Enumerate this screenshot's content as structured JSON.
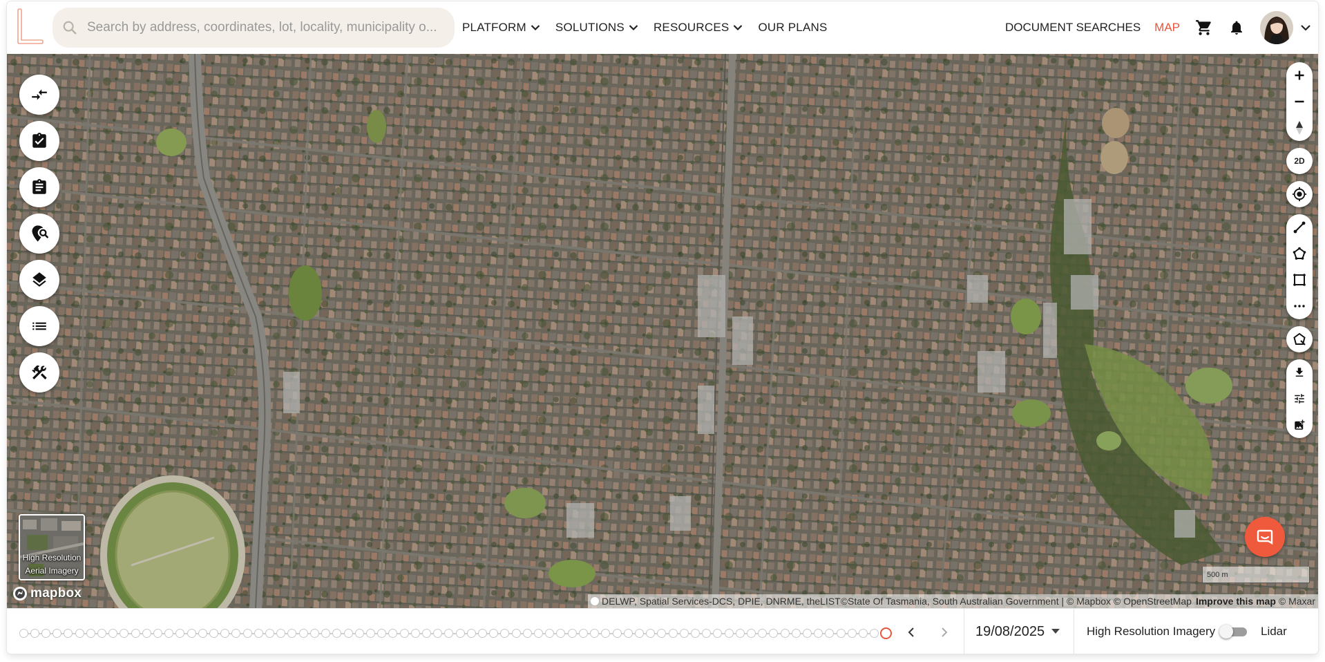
{
  "header": {
    "search": {
      "placeholder": "Search by address, coordinates, lot, locality, municipality o..."
    },
    "nav": [
      {
        "label": "PLATFORM",
        "dropdown": true
      },
      {
        "label": "SOLUTIONS",
        "dropdown": true
      },
      {
        "label": "RESOURCES",
        "dropdown": true
      },
      {
        "label": "OUR PLANS",
        "dropdown": false
      }
    ],
    "document_searches_label": "DOCUMENT SEARCHES",
    "map_label": "MAP",
    "icons": [
      "cart-icon",
      "bell-icon",
      "avatar",
      "chevron-down-icon"
    ]
  },
  "left_toolbar": [
    "compare-arrows-icon",
    "checklist-icon",
    "clipboard-icon",
    "location-search-icon",
    "layers-icon",
    "list-icon",
    "tools-icon"
  ],
  "right_toolbar": {
    "view_mode_label": "2D",
    "icons": [
      "zoom-in-icon",
      "zoom-out-icon",
      "compass-icon",
      "locate-icon",
      "measure-line-icon",
      "polygon-icon",
      "rectangle-icon",
      "more-icon",
      "shape-edit-icon",
      "download-icon",
      "tune-icon",
      "add-image-icon"
    ]
  },
  "map": {
    "basemap_thumb_label": "High Resolution Aerial Imagery",
    "mapbox_label": "mapbox",
    "attribution_text": "DELWP, Spatial Services-DCS, DPIE, DNRME, theLIST©State Of Tasmania, South Australian Government | © Mapbox © OpenStreetMap",
    "improve_link": "Improve this map",
    "maxar": "© Maxar",
    "scale_label": "500 m"
  },
  "timeline": {
    "total_dates": 78,
    "selected_index": 77,
    "selected_date": "19/08/2025",
    "layer_a": "High Resolution Imagery",
    "layer_b": "Lidar",
    "lidar_enabled": false
  },
  "colors": {
    "accent": "#e8553a",
    "chat_button": "#ee5a3b",
    "search_bg": "#f4efe9"
  }
}
